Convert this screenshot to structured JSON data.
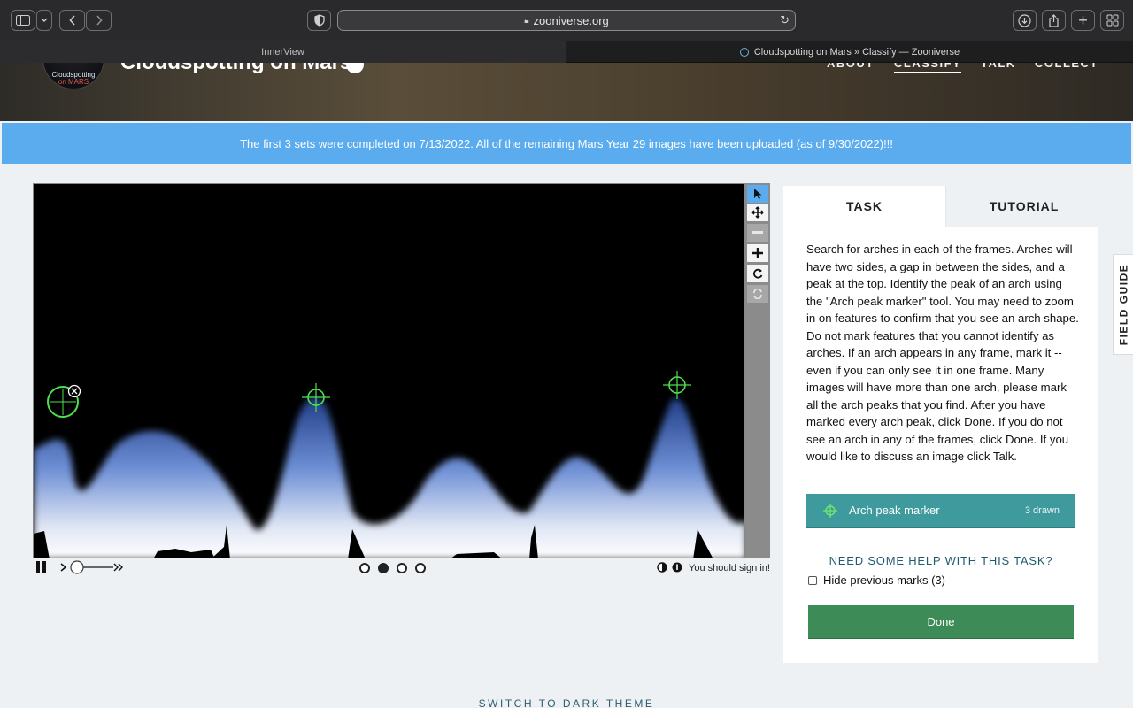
{
  "browser": {
    "url": "zooniverse.org",
    "tabs": [
      {
        "title": "InnerView"
      },
      {
        "title": "Cloudspotting on Mars » Classify — Zooniverse"
      }
    ]
  },
  "header": {
    "logo_text_1": "Cloudspotting",
    "logo_text_2": "on MARS",
    "project_title": "Cloudspotting on Mars",
    "nav": [
      {
        "label": "ABOUT"
      },
      {
        "label": "CLASSIFY",
        "active": true
      },
      {
        "label": "TALK"
      },
      {
        "label": "COLLECT"
      }
    ]
  },
  "announcement": "The first 3 sets were completed on 7/13/2022. All of the remaining Mars Year 29 images have been uploaded (as of 9/30/2022)!!!",
  "viewer": {
    "frames_total": 4,
    "current_frame": 2,
    "markers_count": 3,
    "sign_in_text": "You should sign in!",
    "toolbar": [
      "pointer-icon",
      "move-icon",
      "zoom-out-icon",
      "zoom-in-icon",
      "rotate-icon",
      "reset-icon"
    ]
  },
  "panel": {
    "tabs": [
      {
        "label": "TASK"
      },
      {
        "label": "TUTORIAL"
      }
    ],
    "instructions": "Search for arches in each of the frames. Arches will have two sides, a gap in between the sides, and a peak at the top. Identify the peak of an arch using the \"Arch peak marker\" tool. You may need to zoom in on features to confirm that you see an arch shape. Do not mark features that you cannot identify as arches. If an arch appears in any frame, mark it -- even if you can only see it in one frame. Many images will have more than one arch, please mark all the arch peaks that you find. After you have marked every arch peak, click Done. If you do not see an arch in any of the frames, click Done. If you would like to discuss an image click Talk.",
    "tool": {
      "name": "Arch peak marker",
      "count": "3 drawn",
      "color": "#3f9a9d"
    },
    "help_link": "NEED SOME HELP WITH THIS TASK?",
    "hide_marks": "Hide previous marks (3)",
    "done_label": "Done"
  },
  "field_guide": "FIELD GUIDE",
  "theme_toggle": "SWITCH TO DARK THEME"
}
